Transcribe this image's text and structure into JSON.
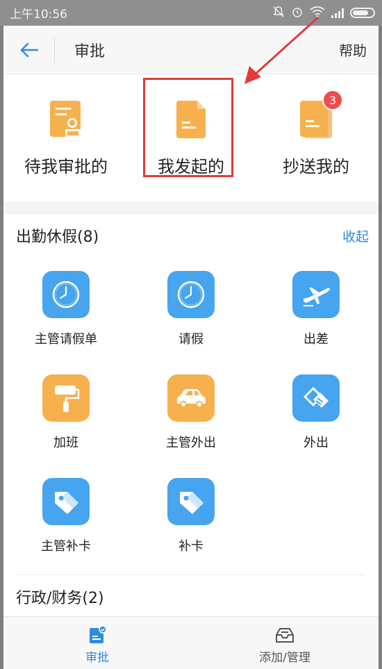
{
  "status_bar": {
    "time": "上午10:56",
    "icons": [
      "mute-icon",
      "alarm-icon",
      "wifi-icon",
      "signal-icon",
      "battery-icon"
    ]
  },
  "header": {
    "back_icon": "back-arrow-icon",
    "title": "审批",
    "help": "帮助"
  },
  "top_cards": [
    {
      "label": "待我审批的",
      "icon": "approval-doc-icon",
      "badge": ""
    },
    {
      "label": "我发起的",
      "icon": "document-icon",
      "badge": ""
    },
    {
      "label": "抄送我的",
      "icon": "copy-docs-icon",
      "badge": "3"
    }
  ],
  "section_leave": {
    "title": "出勤休假(8)",
    "collapse": "收起",
    "items": [
      {
        "label": "主管请假单",
        "icon": "clock-icon",
        "color": "#47a4ee"
      },
      {
        "label": "请假",
        "icon": "clock-icon",
        "color": "#47a4ee"
      },
      {
        "label": "出差",
        "icon": "airplane-icon",
        "color": "#47a4ee"
      },
      {
        "label": "加班",
        "icon": "paint-roller-icon",
        "color": "#f7b04e"
      },
      {
        "label": "主管外出",
        "icon": "car-icon",
        "color": "#f7b04e"
      },
      {
        "label": "外出",
        "icon": "handshake-icon",
        "color": "#47a4ee"
      },
      {
        "label": "主管补卡",
        "icon": "tag-icon",
        "color": "#47a4ee"
      },
      {
        "label": "补卡",
        "icon": "tag-icon",
        "color": "#47a4ee"
      }
    ]
  },
  "section_admin": {
    "title": "行政/财务(2)"
  },
  "tab_bar": {
    "tabs": [
      {
        "label": "审批",
        "icon": "approval-tab-icon",
        "active": true
      },
      {
        "label": "添加/管理",
        "icon": "inbox-tab-icon",
        "active": false
      }
    ]
  },
  "colors": {
    "accent": "#2e8be0",
    "blue_icon": "#47a4ee",
    "orange_icon": "#f7b04e",
    "highlight": "#e03a3a"
  }
}
